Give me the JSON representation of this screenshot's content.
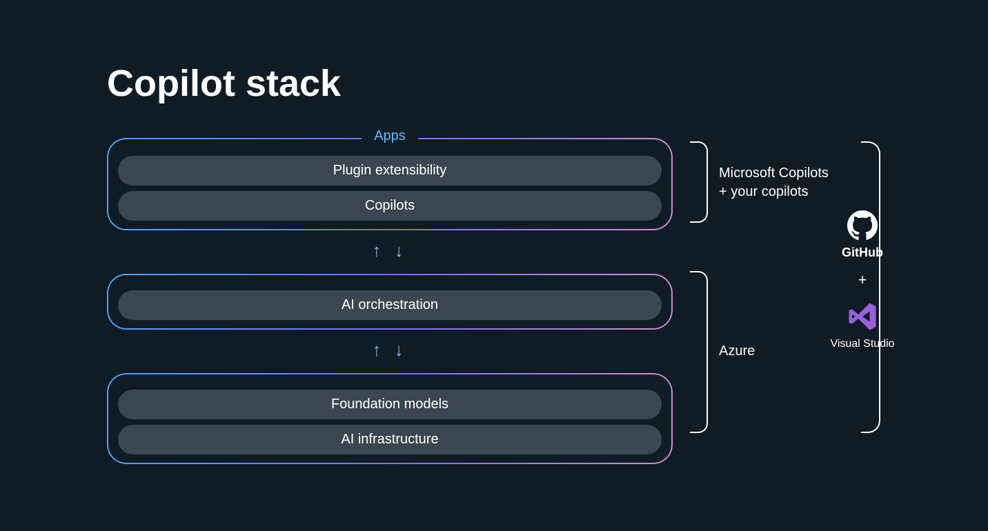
{
  "title": "Copilot stack",
  "groups": {
    "apps": {
      "header": "Apps",
      "items": [
        "Plugin extensibility",
        "Copilots"
      ]
    },
    "orchestration": {
      "items": [
        "AI orchestration"
      ]
    },
    "foundation": {
      "items": [
        "Foundation models",
        "AI infrastructure"
      ]
    }
  },
  "label_top": {
    "line1": "Microsoft Copilots",
    "line2": "+ your copilots"
  },
  "label_bottom": "Azure",
  "tools": {
    "github": "GitHub",
    "plus": "+",
    "vs": "Visual Studio"
  }
}
